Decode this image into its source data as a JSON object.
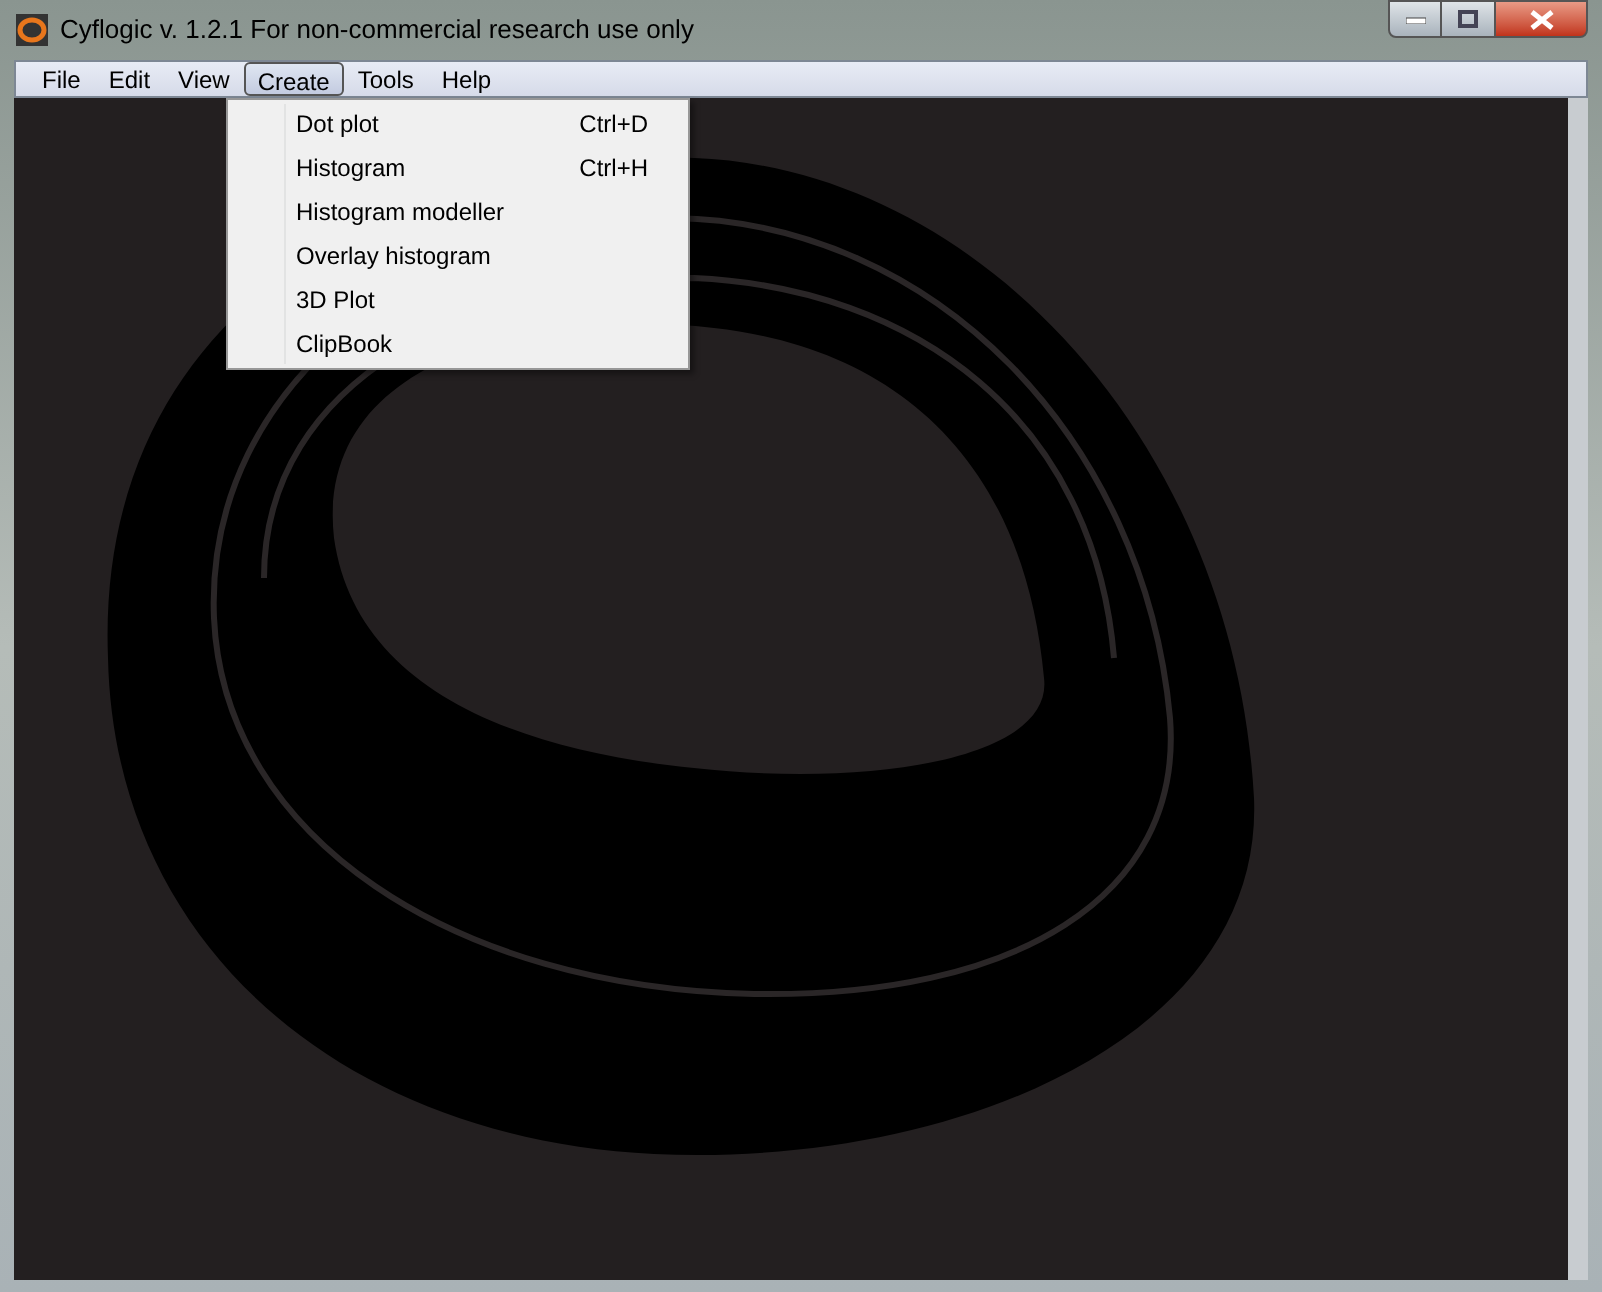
{
  "window": {
    "title": "Cyflogic v. 1.2.1 For non-commercial research use only"
  },
  "menu": [
    {
      "label": "File",
      "selected": false
    },
    {
      "label": "Edit",
      "selected": false
    },
    {
      "label": "View",
      "selected": false
    },
    {
      "label": "Create",
      "selected": true
    },
    {
      "label": "Tools",
      "selected": false
    },
    {
      "label": "Help",
      "selected": false
    }
  ],
  "dropdown": [
    {
      "label": "Dot plot",
      "shortcut": "Ctrl+D"
    },
    {
      "label": "Histogram",
      "shortcut": "Ctrl+H"
    },
    {
      "label": "Histogram modeller"
    },
    {
      "label": "Overlay histogram"
    },
    {
      "label": "3D Plot"
    },
    {
      "label": "ClipBook"
    }
  ]
}
